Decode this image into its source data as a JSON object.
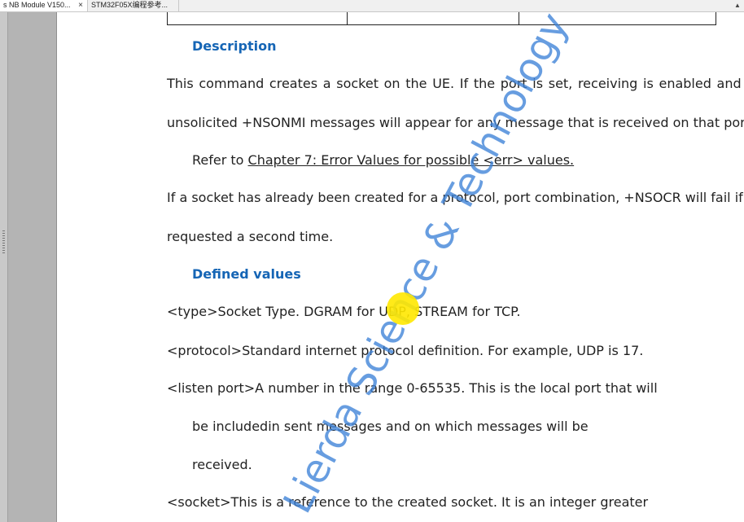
{
  "tabs": [
    {
      "label": "s NB Module V150...",
      "close": "×"
    },
    {
      "label": "STM32F05X编程参考..."
    }
  ],
  "document": {
    "description_heading": "Description",
    "desc_line1": "This command creates a socket on the UE. If the port is set, receiving is enabled and",
    "desc_line2": "unsolicited +NSONMI messages will appear for any message that is received on that port.",
    "refer_prefix": "Refer to ",
    "refer_link": "Chapter 7: Error Values for possible <err> values.",
    "fail_line1": "If a socket has already been created for a protocol, port combination, +NSOCR will fail if",
    "fail_line2": "requested a second time.",
    "defined_heading": "Defined values",
    "type_line": "<type>Socket Type. DGRAM for UDP, STREAM for TCP.",
    "protocol_line": "<protocol>Standard internet protocol definition. For example, UDP is 17.",
    "listen_line1": "<listen port>A number in the range 0-65535. This is the local port that will",
    "listen_line2": "be includedin sent messages and on which messages will be",
    "listen_line3": "received.",
    "socket_line": "<socket>This is a reference to the created socket. It is an integer greater"
  },
  "watermark": "Lierda Science & Technology",
  "colors": {
    "heading": "#1565b5",
    "watermark": "#3c82d7",
    "cursor_highlight": "#ffe800"
  }
}
